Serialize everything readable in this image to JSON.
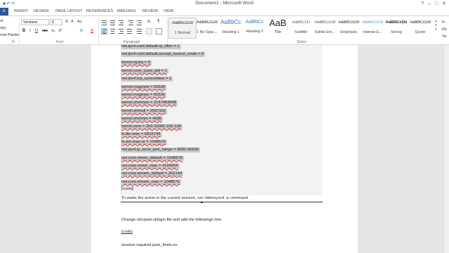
{
  "window": {
    "title": "Document1 - Microsoft Word",
    "controls": "? – □ ✕"
  },
  "tabs": [
    {
      "label": "E",
      "kind": "file"
    },
    {
      "label": "INSERT"
    },
    {
      "label": "DESIGN"
    },
    {
      "label": "PAGE LAYOUT"
    },
    {
      "label": "REFERENCES"
    },
    {
      "label": "MAILINGS"
    },
    {
      "label": "REVIEW"
    },
    {
      "label": "VIEW"
    }
  ],
  "ribbon": {
    "clipboard": {
      "items": [
        "ut",
        "opy",
        "mat Painter"
      ],
      "label": "G"
    },
    "font": {
      "name": "Verdana",
      "size": "8",
      "label": "Font",
      "buttons": [
        "A",
        "A",
        "Aa",
        "B",
        "I",
        "U",
        "abc",
        "x₂",
        "x²",
        "A",
        "A"
      ]
    },
    "paragraph": {
      "label": "Paragraph"
    },
    "styles": {
      "label": "Styles",
      "items": [
        {
          "sample": "AaBbCcDd",
          "name": "1 Normal",
          "selected": true
        },
        {
          "sample": "AaBbCcDd",
          "name": "1 No Spac..."
        },
        {
          "sample": "AaBbCc",
          "name": "Heading 1"
        },
        {
          "sample": "AaBbCc",
          "name": "Heading 2"
        },
        {
          "sample": "AaB",
          "name": "Title"
        },
        {
          "sample": "AaBbCcD",
          "name": "Subtitle"
        },
        {
          "sample": "AaBbCcDd",
          "name": "Subtle Em..."
        },
        {
          "sample": "AaBbCcDd",
          "name": "Emphasis"
        },
        {
          "sample": "AaBbCcDd",
          "name": "Intense E..."
        },
        {
          "sample": "AaBbCcDc",
          "name": "Strong"
        },
        {
          "sample": "AaBbCcDd",
          "name": "Quote"
        }
      ]
    },
    "editing": [
      "Fi",
      "Re",
      "Se"
    ]
  },
  "document": {
    "code_lines": [
      "net.ipv4.conf.default.rp_filter = 1",
      "net.ipv4.conf.default.accept_source_route = 0",
      "kernel.sysrq = 0",
      "kernel.core_uses_pid = 1",
      "net.ipv4.tcp_syncookies = 1",
      "kernel.msgmnb = 65536",
      "kernel.msgmax = 65536",
      "kernel.shmmax = 2147483648",
      "kernel.shmall = 2097152",
      "kernel.shmmni = 4096",
      "kernel.sem = 250 32000 100 128",
      "fs.file-max = 6815744",
      "fs.aio-max-nr = 1048576",
      "net.ipv4.ip_local_port_range = 9000 65500",
      "net.core.rmem_default = 1048576",
      "net.core.rmem_max = 4194304",
      "net.core.wmem_default = 262144",
      "net.core.wmem_max = 1048576"
    ],
    "code_end": "[/code]",
    "instruction": "To make the active in the current session, run /sbin/sysctl -p command",
    "pam_intro": "Change /etc/pam.d/login file and add the followingn line:",
    "code_start": "[code]",
    "pam_line": "session required pam_limits.so"
  }
}
